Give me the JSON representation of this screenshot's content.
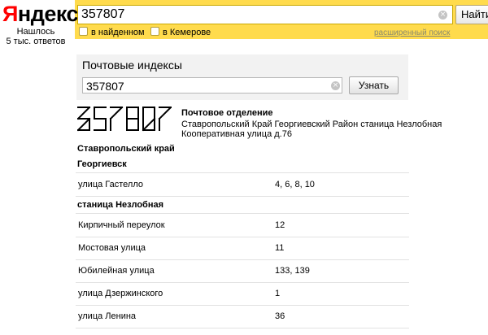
{
  "header": {
    "logo_first": "Я",
    "logo_rest": "ндекс",
    "found_line1": "Нашлось",
    "found_line2": "5 тыс. ответов",
    "search_value": "357807",
    "find_label": "Найти",
    "filter_found": "в найденном",
    "filter_city": "в Кемерове",
    "advanced_search": "расширенный поиск",
    "clear_icon": "×"
  },
  "widget": {
    "title": "Почтовые индексы",
    "input_value": "357807",
    "button_label": "Узнать",
    "clear_icon": "×"
  },
  "postcode": {
    "digits": "357807",
    "office_title": "Почтовое отделение",
    "address_line1": "Ставропольский Край Георгиевский Район станица Незлобная",
    "address_line2": "Кооперативная улица д.76"
  },
  "streets": {
    "region": "Ставропольский край",
    "groups": [
      {
        "name": "Георгиевск",
        "rows": [
          {
            "street": "улица Гастелло",
            "numbers": "4, 6, 8, 10"
          }
        ]
      },
      {
        "name": "станица Незлобная",
        "rows": [
          {
            "street": "Кирпичный переулок",
            "numbers": "12"
          },
          {
            "street": "Мостовая улица",
            "numbers": "11"
          },
          {
            "street": "Юбилейная улица",
            "numbers": "133, 139"
          },
          {
            "street": "улица Дзержинского",
            "numbers": "1"
          },
          {
            "street": "улица Ленина",
            "numbers": "36"
          }
        ]
      }
    ]
  }
}
